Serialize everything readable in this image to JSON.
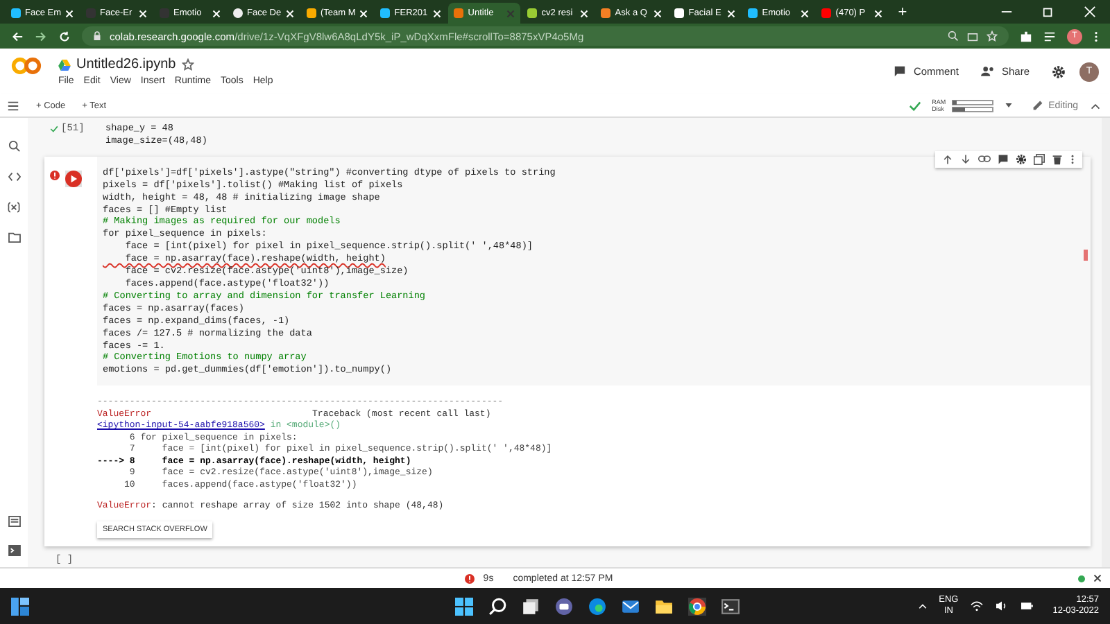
{
  "browser": {
    "tabs": [
      {
        "label": "Face Em",
        "selected": false
      },
      {
        "label": "Face-Er",
        "selected": false
      },
      {
        "label": "Emotio",
        "selected": false
      },
      {
        "label": "Face De",
        "selected": false
      },
      {
        "label": "(Team M",
        "selected": false
      },
      {
        "label": "FER201",
        "selected": false
      },
      {
        "label": "Untitle",
        "selected": true
      },
      {
        "label": "cv2 resi",
        "selected": false
      },
      {
        "label": "Ask a Q",
        "selected": false
      },
      {
        "label": "Facial E",
        "selected": false
      },
      {
        "label": "Emotio",
        "selected": false
      },
      {
        "label": "(470) P",
        "selected": false
      }
    ],
    "new_tab": "+",
    "url": "colab.research.google.com",
    "url_path": "/drive/1z-VqXFgV8lw6A8qLdY5k_iP_wDqXxmFle#scrollTo=8875xVP4o5Mg",
    "profile": "T"
  },
  "notebook": {
    "title": "Untitled26.ipynb",
    "menu": [
      "File",
      "Edit",
      "View",
      "Insert",
      "Runtime",
      "Tools",
      "Help"
    ],
    "comment": "Comment",
    "share": "Share",
    "avatar": "T",
    "add_code": "+ Code",
    "add_text": "+ Text",
    "ram": "RAM",
    "disk": "Disk",
    "editing": "Editing"
  },
  "cells": [
    {
      "kind": "done",
      "exec": "[51]",
      "lines": [
        {
          "kind": "code",
          "text": "shape_y = 48"
        },
        {
          "kind": "code",
          "text": "image_size=(48,48)"
        }
      ]
    },
    {
      "kind": "error",
      "lines": [
        {
          "kind": "code",
          "text": "df['pixels']=df['pixels'].astype(\"string\") #converting dtype of pixels to string"
        },
        {
          "kind": "code",
          "text": "pixels = df['pixels'].tolist() #Making list of pixels"
        },
        {
          "kind": "code",
          "text": "width, height = 48, 48 # initializing image shape"
        },
        {
          "kind": "code",
          "text": "faces = [] #Empty list"
        },
        {
          "kind": "comment",
          "text": "# Making images as required for our models"
        },
        {
          "kind": "code",
          "text": "for pixel_sequence in pixels:"
        },
        {
          "kind": "code",
          "text": "    face = [int(pixel) for pixel in pixel_sequence.strip().split(' ',48*48)]"
        },
        {
          "kind": "squiggle",
          "text": "    face = np.asarray(face).reshape(width, height)"
        },
        {
          "kind": "code",
          "text": "    face = cv2.resize(face.astype('uint8'),image_size)"
        },
        {
          "kind": "code",
          "text": "    faces.append(face.astype('float32'))"
        },
        {
          "kind": "comment",
          "text": "# Converting to array and dimension for transfer Learning"
        },
        {
          "kind": "code",
          "text": "faces = np.asarray(faces)"
        },
        {
          "kind": "code",
          "text": "faces = np.expand_dims(faces, -1)"
        },
        {
          "kind": "code",
          "text": "faces /= 127.5 # normalizing the data"
        },
        {
          "kind": "code",
          "text": "faces -= 1."
        },
        {
          "kind": "comment",
          "text": "# Converting Emotions to numpy array"
        },
        {
          "kind": "code",
          "text": "emotions = pd.get_dummies(df['emotion']).to_numpy()"
        }
      ],
      "output": {
        "rule": "---------------------------------------------------------------------------",
        "error_name": "ValueError",
        "traceback": "Traceback (most recent call last)",
        "link": "<ipython-input-54-aabfe918a560>",
        "where": "in <module>()",
        "frames": [
          {
            "kind": "normal",
            "text": "      6 for pixel_sequence in pixels:"
          },
          {
            "kind": "normal",
            "text": "      7     face = [int(pixel) for pixel in pixel_sequence.strip().split(' ',48*48)]"
          },
          {
            "kind": "current",
            "text": "----> 8     face = np.asarray(face).reshape(width, height)"
          },
          {
            "kind": "normal",
            "text": "      9     face = cv2.resize(face.astype('uint8'),image_size)"
          },
          {
            "kind": "normal",
            "text": "     10     faces.append(face.astype('float32'))"
          }
        ],
        "message_name": "ValueError",
        "message": ": cannot reshape array of size 1502 into shape (48,48)",
        "button": "SEARCH STACK OVERFLOW"
      }
    },
    {
      "kind": "empty",
      "exec": "[ ]"
    }
  ],
  "status": {
    "time": "9s",
    "text": "completed at 12:57 PM"
  },
  "taskbar": {
    "lang": "ENG",
    "region": "IN",
    "clock": "12:57",
    "date": "12-03-2022"
  }
}
